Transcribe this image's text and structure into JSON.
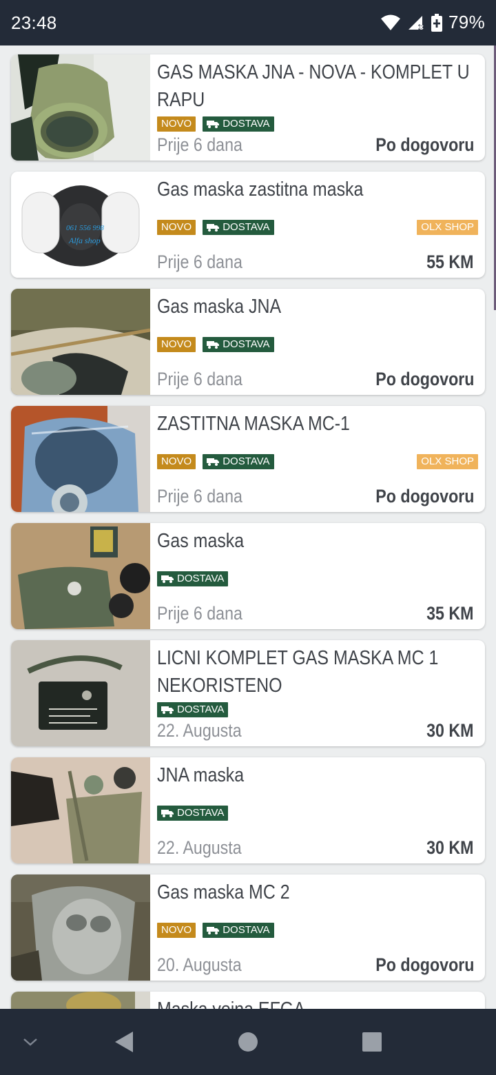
{
  "status_bar": {
    "time": "23:48",
    "battery_percent": "79%",
    "icons": [
      "wifi-icon",
      "signal-icon",
      "battery-charging-icon"
    ]
  },
  "colors": {
    "novo_badge": "#c48a1c",
    "dostava_badge": "#245b3e",
    "shop_badge": "#f0b35b",
    "system_bar": "#232b38"
  },
  "badges": {
    "novo": "NOVO",
    "dostava": "DOSTAVA",
    "shop": "OLX SHOP"
  },
  "listings": [
    {
      "title": "GAS MASKA JNA - NOVA - KOMPLET U RAPU",
      "novo": true,
      "dostava": true,
      "shop": false,
      "date": "Prije 6 dana",
      "price": "Po dogovoru",
      "thumb": "green-gas-mask-photo"
    },
    {
      "title": "Gas maska zastitna maska",
      "novo": true,
      "dostava": true,
      "shop": true,
      "date": "Prije 6 dana",
      "price": "55 KM",
      "thumb": "half-face-respirator-photo",
      "watermark": [
        "061 556 998",
        "Alfa shop"
      ]
    },
    {
      "title": "Gas maska JNA",
      "novo": true,
      "dostava": true,
      "shop": false,
      "date": "Prije 6 dana",
      "price": "Po dogovoru",
      "thumb": "gas-mask-bag-photo"
    },
    {
      "title": "ZASTITNA MASKA MC-1",
      "novo": true,
      "dostava": true,
      "shop": true,
      "date": "Prije 6 dana",
      "price": "Po dogovoru",
      "thumb": "wrapped-mask-photo"
    },
    {
      "title": "Gas maska",
      "novo": false,
      "dostava": true,
      "shop": false,
      "date": "Prije 6 dana",
      "price": "35 KM",
      "thumb": "mask-kit-on-cardboard-photo"
    },
    {
      "title": "LICNI KOMPLET GAS MASKA MC 1 NEKORISTENO",
      "novo": false,
      "dostava": true,
      "shop": false,
      "date": "22. Augusta",
      "price": "30 KM",
      "thumb": "mask-bag-photo"
    },
    {
      "title": "JNA maska",
      "novo": false,
      "dostava": true,
      "shop": false,
      "date": "22. Augusta",
      "price": "30 KM",
      "thumb": "mask-and-bag-on-floor-photo"
    },
    {
      "title": "Gas maska MC 2",
      "novo": true,
      "dostava": true,
      "shop": false,
      "date": "20. Augusta",
      "price": "Po dogovoru",
      "thumb": "clear-mask-in-bag-photo"
    },
    {
      "title": "Maska vojna EFGA",
      "novo": false,
      "dostava": false,
      "shop": false,
      "date": "",
      "price": "",
      "thumb": "partial-listing-photo"
    }
  ],
  "nav_bar": {
    "buttons": [
      "chevron-down-icon",
      "back-icon",
      "home-icon",
      "recents-icon"
    ]
  }
}
